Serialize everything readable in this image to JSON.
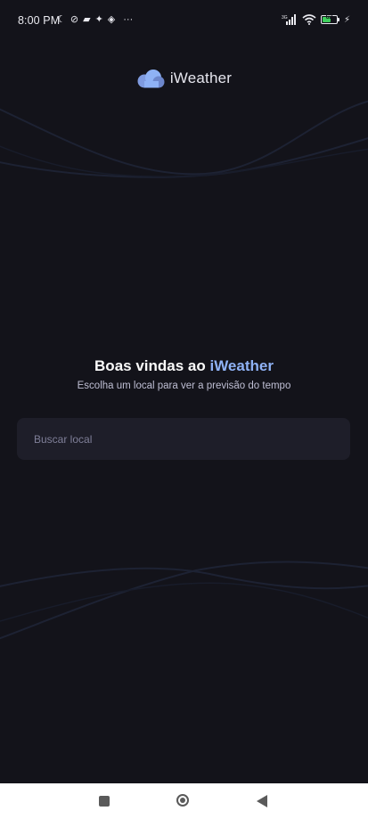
{
  "status_bar": {
    "time": "8:00 PM",
    "left_icons": [
      "moon-icon",
      "notifications-off-icon",
      "message-icon",
      "sparkle-icon",
      "location-icon",
      "more-icon"
    ],
    "right_icons": [
      "signal-icon",
      "wifi-icon",
      "battery-icon",
      "charging-icon"
    ],
    "battery_level": "62",
    "battery_fraction": 0.62,
    "network_label": "3G"
  },
  "logo": {
    "text": "iWeather",
    "icon": "cloud-logo-icon"
  },
  "welcome": {
    "title_prefix": "Boas vindas ao ",
    "title_brand": "iWeather",
    "subtitle": "Escolha um local para ver a previsão do tempo"
  },
  "search": {
    "placeholder": "Buscar local",
    "value": ""
  },
  "navigation": {
    "buttons": [
      "recents-button",
      "home-button",
      "back-button"
    ]
  },
  "colors": {
    "background": "#13131a",
    "accent": "#8fb2f5",
    "input_background": "#1e1e29",
    "placeholder": "#7f7f98",
    "battery": "#3ecf5c"
  }
}
